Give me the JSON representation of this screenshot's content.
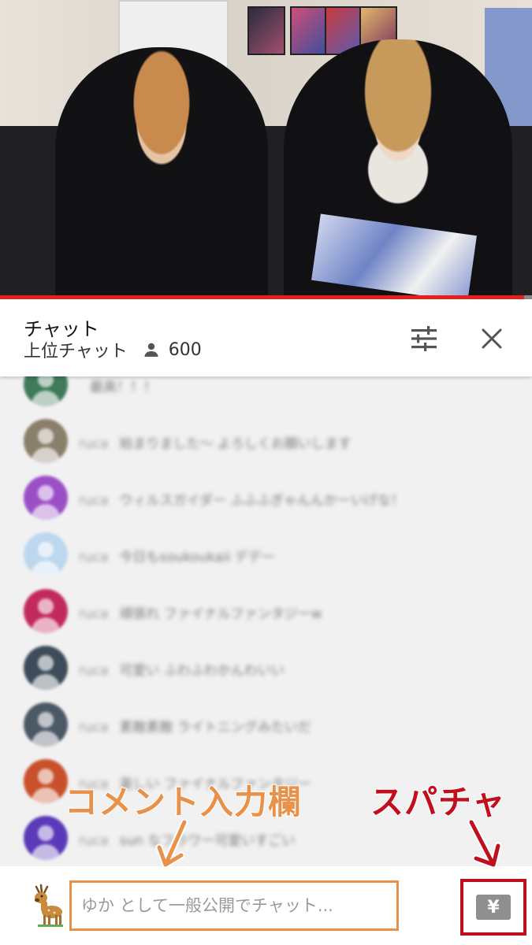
{
  "video": {
    "progress_fraction": 0.985,
    "progress_color": "#e3201b"
  },
  "chat_header": {
    "title": "チャット",
    "mode_label": "上位チャット",
    "viewer_count": "600",
    "icons": {
      "viewers": "person-icon",
      "filter": "tune-sliders-icon",
      "close": "close-x-icon"
    }
  },
  "messages": [
    {
      "author": "",
      "text": "最高！！！",
      "avatar_color": "#3f7a5a"
    },
    {
      "author": "ruca",
      "text": "始まりました〜 よろしくお願いします",
      "avatar_color": "#8a7f6a"
    },
    {
      "author": "ruca",
      "text": "ウィルスガイダー ふふふぎゃんんかーいげな！",
      "avatar_color": "#9b4fc7"
    },
    {
      "author": "ruca",
      "text": "今日もsoukoukaii デデー",
      "avatar_color": "#bcd7ee"
    },
    {
      "author": "ruca",
      "text": "頑張れ ファイナルファンタジーw",
      "avatar_color": "#c22a5d"
    },
    {
      "author": "ruca",
      "text": "可愛い ふわふわかんわいい",
      "avatar_color": "#3d4b5a"
    },
    {
      "author": "ruca",
      "text": "素敵素敵 ライトニングみたいだ",
      "avatar_color": "#4b5866"
    },
    {
      "author": "ruca",
      "text": "楽しい ファイナルファンタジー",
      "avatar_color": "#c8502a"
    },
    {
      "author": "ruca",
      "text": "sun なフラワー可愛いすごい",
      "avatar_color": "#5a3ab8"
    }
  ],
  "annotations": {
    "comment_field_label": "コメント入力欄",
    "superchat_label": "スパチャ",
    "comment_color": "#e8914a",
    "superchat_color": "#c0101e"
  },
  "input_bar": {
    "placeholder": "ゆか として一般公開でチャット...",
    "superchat_button_label": "¥",
    "user_avatar_icon": "deer-avatar-icon"
  }
}
